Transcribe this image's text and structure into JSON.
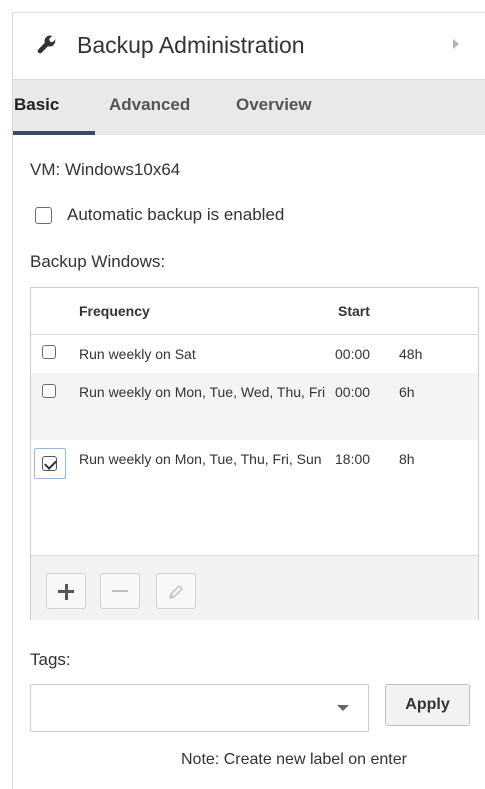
{
  "header": {
    "title": "Backup Administration",
    "icon": "wrench-icon"
  },
  "tabs": [
    {
      "label": "Basic",
      "active": true
    },
    {
      "label": "Advanced",
      "active": false
    },
    {
      "label": "Overview",
      "active": false
    }
  ],
  "vm": {
    "label": "VM: Windows10x64"
  },
  "automatic_backup": {
    "label": "Automatic backup is enabled",
    "checked": false
  },
  "backup_windows": {
    "label": "Backup Windows:",
    "columns": {
      "frequency": "Frequency",
      "start": "Start"
    },
    "rows": [
      {
        "frequency": "Run weekly on Sat",
        "start": "00:00",
        "duration": "48h",
        "checked": false
      },
      {
        "frequency": "Run weekly on Mon, Tue, Wed, Thu, Fri",
        "start": "00:00",
        "duration": "6h",
        "checked": false
      },
      {
        "frequency": "Run weekly on Mon, Tue, Thu, Fri, Sun",
        "start": "18:00",
        "duration": "8h",
        "checked": true
      }
    ],
    "toolbar": {
      "add_icon": "plus-icon",
      "remove_icon": "minus-icon",
      "edit_icon": "pencil-icon"
    }
  },
  "tags": {
    "label": "Tags:",
    "value": "",
    "apply_label": "Apply",
    "note": "Note: Create new label on enter"
  },
  "colors": {
    "active_tab_underline": "#3c4b61",
    "tabbar_bg": "#e9e9e9",
    "focus_border": "#9bb8d8"
  }
}
